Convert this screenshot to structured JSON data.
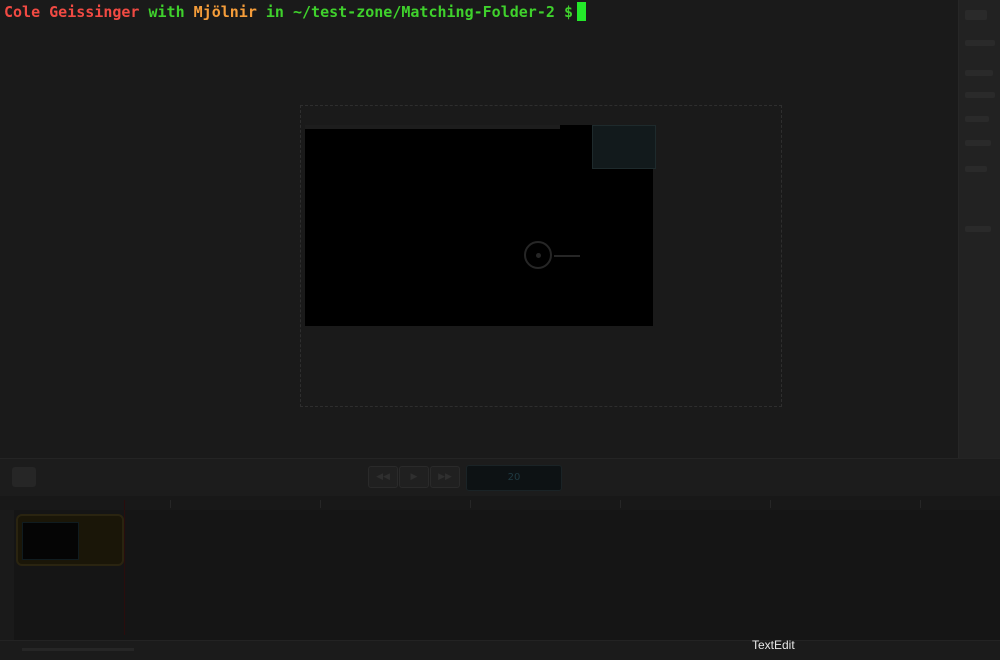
{
  "terminal": {
    "user": "Cole Geissinger",
    "with_word": "with",
    "host": "Mjölnir",
    "in_word": "in",
    "path": "~/test-zone/Matching-Folder-2",
    "prompt_symbol": "$"
  },
  "background_app": {
    "toolbar": {
      "rewind_icon": "rewind-icon",
      "play_icon": "play-icon",
      "forward_icon": "fast-forward-icon",
      "fps_value": "20"
    }
  },
  "dock_label": "TextEdit",
  "colors": {
    "user": "#f14a43",
    "host": "#f59d3a",
    "green": "#3fd12c",
    "cursor": "#24e82a"
  }
}
